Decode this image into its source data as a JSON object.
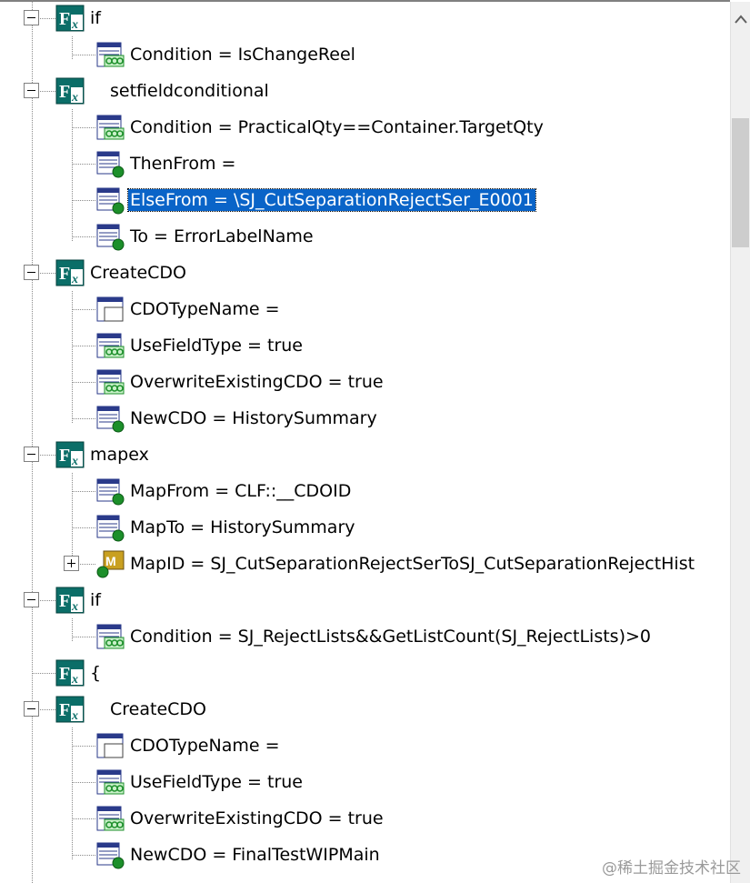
{
  "tree": {
    "rows": [
      {
        "label": "if",
        "icon": "function-icon",
        "expander": "minus",
        "selected": false
      },
      {
        "label": "Condition = IsChangeReel",
        "icon": "condition-icon",
        "selected": false
      },
      {
        "label": "setfieldconditional",
        "icon": "function-icon",
        "expander": "minus",
        "selected": false
      },
      {
        "label": "Condition = PracticalQty==Container.TargetQty",
        "icon": "condition-icon",
        "selected": false
      },
      {
        "label": "ThenFrom =",
        "icon": "field-ref-icon",
        "selected": false
      },
      {
        "label": "ElseFrom = \\SJ_CutSeparationRejectSer_E0001",
        "icon": "field-ref-icon",
        "selected": true
      },
      {
        "label": "To = ErrorLabelName",
        "icon": "field-ref-icon",
        "selected": false
      },
      {
        "label": "CreateCDO",
        "icon": "function-icon",
        "expander": "minus",
        "selected": false
      },
      {
        "label": "CDOTypeName =",
        "icon": "window-icon",
        "selected": false
      },
      {
        "label": "UseFieldType = true",
        "icon": "condition-icon",
        "selected": false
      },
      {
        "label": "OverwriteExistingCDO = true",
        "icon": "condition-icon",
        "selected": false
      },
      {
        "label": "NewCDO = HistorySummary",
        "icon": "field-ref-icon",
        "selected": false
      },
      {
        "label": "mapex",
        "icon": "function-icon",
        "expander": "minus",
        "selected": false
      },
      {
        "label": "MapFrom = CLF::__CDOID",
        "icon": "field-ref-icon",
        "selected": false
      },
      {
        "label": "MapTo = HistorySummary",
        "icon": "field-ref-icon",
        "selected": false
      },
      {
        "label": "MapID = SJ_CutSeparationRejectSerToSJ_CutSeparationRejectHist",
        "icon": "map-icon",
        "expander": "plus",
        "selected": false
      },
      {
        "label": "if",
        "icon": "function-icon",
        "expander": "minus",
        "selected": false
      },
      {
        "label": "Condition = SJ_RejectLists&&GetListCount(SJ_RejectLists)>0",
        "icon": "condition-icon",
        "selected": false
      },
      {
        "label": "{",
        "icon": "function-icon",
        "selected": false
      },
      {
        "label": "CreateCDO",
        "icon": "function-icon",
        "expander": "minus",
        "selected": false
      },
      {
        "label": "CDOTypeName =",
        "icon": "window-icon",
        "selected": false
      },
      {
        "label": "UseFieldType = true",
        "icon": "condition-icon",
        "selected": false
      },
      {
        "label": "OverwriteExistingCDO = true",
        "icon": "condition-icon",
        "selected": false
      },
      {
        "label": "NewCDO = FinalTestWIPMain",
        "icon": "field-ref-icon",
        "selected": false
      }
    ]
  },
  "scrollbar": {
    "up_arrow": "chevron-up-icon"
  },
  "watermark": "@稀土掘金技术社区",
  "colors": {
    "selection": "#0a64c8",
    "function_icon": "#0b6e68",
    "ref_dot": "#1c8f2a"
  }
}
